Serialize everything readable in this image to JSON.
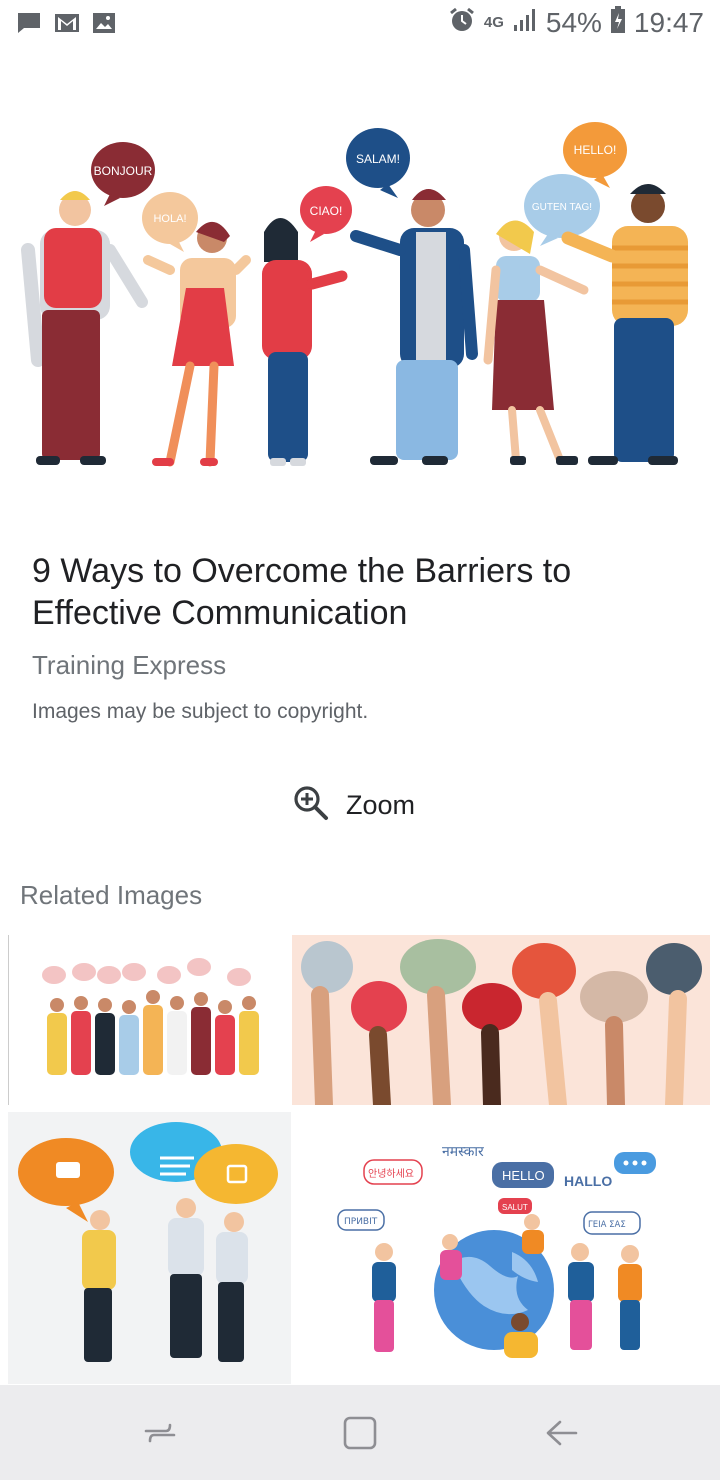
{
  "status_bar": {
    "icons_left": [
      "message-icon",
      "gmail-icon",
      "image-icon"
    ],
    "icons_right": [
      "alarm-icon",
      "signal-icon"
    ],
    "network": "4G",
    "battery": "54%",
    "time": "19:47"
  },
  "hero": {
    "speech_bubbles": [
      "BONJOUR",
      "HOLA!",
      "CIAO!",
      "SALAM!",
      "GUTEN TAG!",
      "HELLO!"
    ]
  },
  "result": {
    "title": "9 Ways to Overcome the Barriers to Effective Communication",
    "source": "Training Express",
    "copyright": "Images may be subject to copyright."
  },
  "zoom": {
    "label": "Zoom",
    "icon": "zoom-in-icon"
  },
  "related": {
    "heading": "Related Images",
    "thumb4_words": [
      "नमस्कार",
      "안녕하세요",
      "HELLO",
      "HALLO",
      "ПРИВІТ",
      "SALUT",
      "ΓΕΙΑ ΣΑΣ"
    ]
  },
  "nav_bar": {
    "buttons": [
      "recent-apps-icon",
      "home-icon",
      "back-icon"
    ]
  }
}
